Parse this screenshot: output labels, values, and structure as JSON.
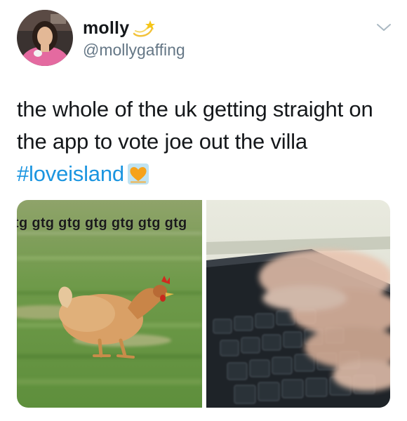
{
  "tweet": {
    "author": {
      "display_name": "molly",
      "handle": "@mollygaffing",
      "avatar_icon": "profile-photo",
      "name_emoji": "dizzy-star-emoji"
    },
    "menu_icon": "chevron-down-icon",
    "text_line1": "the whole of the uk getting straight on",
    "text_line2": "the app to vote joe out the villa",
    "hashtag": "#loveisland",
    "hashtag_emoji": "orange-heart-emoji",
    "colors": {
      "hashtag": "#1b95e0",
      "secondary_text": "#657786",
      "primary_text": "#14171a"
    }
  },
  "media": {
    "left_image": {
      "subject": "chicken-running-on-grass",
      "caption": "tg gtg gtg gtg gtg gtg gtg"
    },
    "right_image": {
      "subject": "hands-typing-on-keyboard"
    }
  }
}
